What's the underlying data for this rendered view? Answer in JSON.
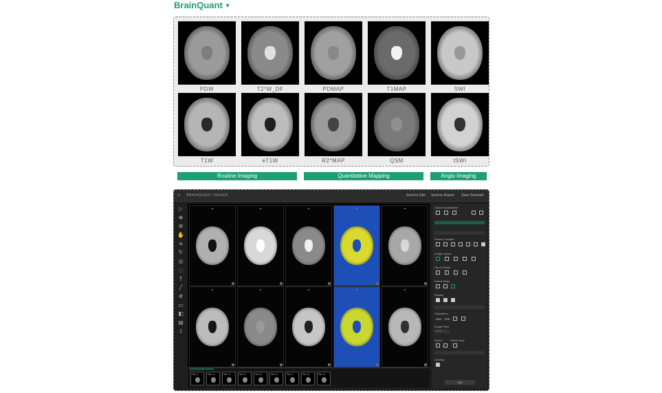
{
  "brand": {
    "name": "BrainQuant",
    "caret": "▼"
  },
  "top_grid": {
    "row1": [
      {
        "caption": "PDW",
        "tone": "#9a9a9a",
        "vent": "#7d7d7d"
      },
      {
        "caption": "T2*W_DF",
        "tone": "#8a8a8a",
        "vent": "#e0e0e0"
      },
      {
        "caption": "PDMAP",
        "tone": "#a0a0a0",
        "vent": "#888888"
      },
      {
        "caption": "T1MAP",
        "tone": "#6a6a6a",
        "vent": "#f2f2f2"
      },
      {
        "caption": "SWI",
        "tone": "#c8c8c8",
        "vent": "#999999"
      }
    ],
    "row2": [
      {
        "caption": "T1W",
        "tone": "#b5b5b5",
        "vent": "#2a2a2a"
      },
      {
        "caption": "eT1W",
        "tone": "#bdbdbd",
        "vent": "#1f1f1f"
      },
      {
        "caption": "R2*MAP",
        "tone": "#9c9c9c",
        "vent": "#444444"
      },
      {
        "caption": "QSM",
        "tone": "#7a7a7a",
        "vent": "#8f8f8f"
      },
      {
        "caption": "tSWI",
        "tone": "#d2d2d2",
        "vent": "#333333"
      }
    ]
  },
  "categories": [
    "Routine Imaging",
    "Quantitative Mapping",
    "Angio Imaging"
  ],
  "app": {
    "title": "BRAINQUANT VIEWER",
    "actions": [
      "Send to Film",
      "Send to Report",
      "Save Selected"
    ],
    "tool_icons": [
      "pointer-icon",
      "move-icon",
      "zoom-icon",
      "pan-icon",
      "contrast-icon",
      "rotate-icon",
      "reset-icon",
      "lasso-icon",
      "text-icon",
      "line-icon",
      "grid-icon",
      "measure-icon",
      "invert-icon",
      "layer-icon",
      "export-icon"
    ],
    "tool_glyphs": [
      "▷",
      "✥",
      "⊕",
      "✋",
      "☀",
      "↻",
      "◎",
      "◌",
      "T",
      "╱",
      "#",
      "▭",
      "◧",
      "▤",
      "⇩"
    ],
    "top_row_tones": [
      "#b0b0b0",
      "#d8d8d8",
      "#8a8a8a",
      "#d9d92e",
      "#a8a8a8"
    ],
    "top_row_vents": [
      "#111111",
      "#ffffff",
      "#f0f0f0",
      "#1e4fb8",
      "#d8d8d8"
    ],
    "bottom_row_tones": [
      "#bcbcbc",
      "#8a8a8a",
      "#c6c6c6",
      "#c8d830",
      "#b8b8b8"
    ],
    "bottom_row_vents": [
      "#151515",
      "#9a9a9a",
      "#202020",
      "#1e4fb8",
      "#303030"
    ],
    "thumbs": [
      "Ser 1",
      "Ser 2",
      "Ser 3",
      "Ser 4",
      "Ser 5",
      "Ser 6",
      "Ser 7",
      "Ser 8",
      "Ser 9"
    ],
    "thumbs_label": "BrainQuant Series",
    "sidebar": {
      "sections": [
        "Choose Application",
        "Series Compare",
        "Image Layout",
        "Flip & Rotate",
        "Select Mode",
        "Display",
        "Calculation",
        "Image Filter",
        "Select",
        "Overlay"
      ],
      "calc_labels": [
        "ADD",
        "SUB"
      ],
      "select_labels": [
        "Select",
        "Select Area"
      ],
      "filter_value": "None",
      "exit": "Exit"
    }
  }
}
